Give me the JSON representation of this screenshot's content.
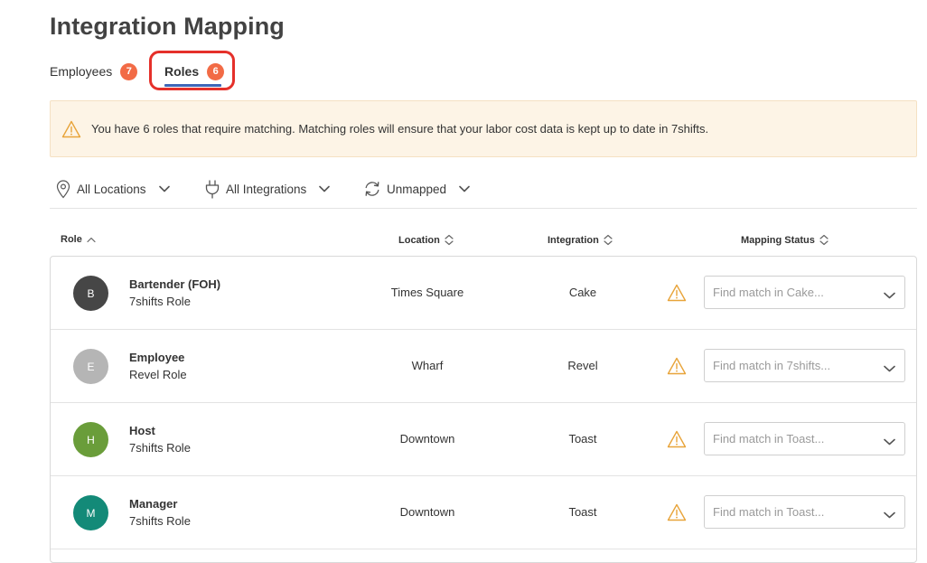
{
  "page": {
    "title": "Integration Mapping"
  },
  "tabs": [
    {
      "label": "Employees",
      "count": "7"
    },
    {
      "label": "Roles",
      "count": "6"
    }
  ],
  "alert": {
    "icon": "warning-icon",
    "text": "You have 6 roles that require matching. Matching roles will ensure that your labor cost data is kept up to date in 7shifts."
  },
  "filters": [
    {
      "icon": "location-pin-icon",
      "label": "All Locations"
    },
    {
      "icon": "plug-icon",
      "label": "All Integrations"
    },
    {
      "icon": "refresh-icon",
      "label": "Unmapped"
    }
  ],
  "columns": {
    "role": "Role",
    "location": "Location",
    "integration": "Integration",
    "mapping_status": "Mapping Status"
  },
  "rows": [
    {
      "initial": "B",
      "avatar_color": "#464646",
      "name": "Bartender (FOH)",
      "sub": "7shifts Role",
      "location": "Times Square",
      "integration": "Cake",
      "placeholder": "Find match in Cake..."
    },
    {
      "initial": "E",
      "avatar_color": "#b5b5b5",
      "name": "Employee",
      "sub": "Revel Role",
      "location": "Wharf",
      "integration": "Revel",
      "placeholder": "Find match in 7shifts..."
    },
    {
      "initial": "H",
      "avatar_color": "#6a9d3a",
      "name": "Host",
      "sub": "7shifts Role",
      "location": "Downtown",
      "integration": "Toast",
      "placeholder": "Find match in Toast..."
    },
    {
      "initial": "M",
      "avatar_color": "#138a78",
      "name": "Manager",
      "sub": "7shifts Role",
      "location": "Downtown",
      "integration": "Toast",
      "placeholder": "Find match in Toast..."
    }
  ],
  "colors": {
    "badge": "#f26b46",
    "tab_underline": "#3f67b8",
    "highlight": "#e5302a",
    "alert_bg": "#fdf4e6",
    "warning": "#e8a43a"
  }
}
